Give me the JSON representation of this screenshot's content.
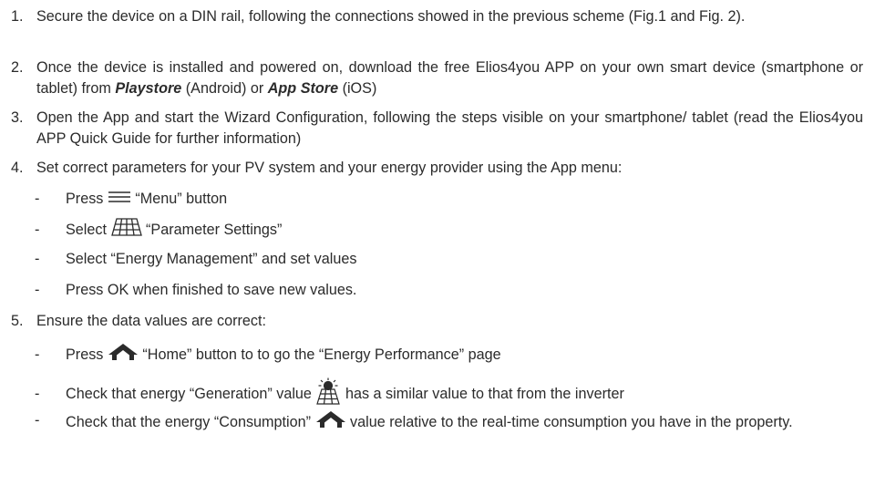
{
  "steps": [
    {
      "num": "1.",
      "text": "Secure the device on a DIN rail, following the connections showed in the previous scheme (Fig.1 and Fig. 2)."
    },
    {
      "num": "2.",
      "text_a": "Once the device is installed and powered on, download the free Elios4you APP on your own smart device (smartphone or tablet) from ",
      "link_playstore": "Playstore",
      "text_b": " (Android) or ",
      "link_appstore": "App Store",
      "text_c": " (iOS)"
    },
    {
      "num": "3.",
      "text": "Open the App and start the Wizard Configuration, following the steps visible on your smartphone/ tablet (read the Elios4you APP Quick Guide for further information)"
    },
    {
      "num": "4.",
      "text": "Set correct parameters for your PV system and your energy provider using the App menu:",
      "subs": [
        {
          "dash": "-",
          "pre": "Press",
          "post": "“Menu” button"
        },
        {
          "dash": "-",
          "pre": "Select",
          "post": "“Parameter Settings”"
        },
        {
          "dash": "-",
          "text": "Select “Energy Management” and set values"
        },
        {
          "dash": "-",
          "text": "Press OK when finished to save new values."
        }
      ]
    },
    {
      "num": "5.",
      "text": "Ensure the data values are correct:",
      "subs": [
        {
          "dash": "-",
          "pre": "Press",
          "post": "“Home” button to to go the “Energy Performance” page"
        },
        {
          "dash": "-",
          "pre": "Check that energy “Generation” value",
          "post": "has a similar value to that from the inverter"
        },
        {
          "dash": "-",
          "pre": "Check that the energy “Consumption”",
          "post": "value relative to the real-time consumption you have in the property."
        }
      ]
    }
  ],
  "icons": {
    "menu": "menu-lines-icon",
    "parameters": "grid-panel-icon",
    "home": "home-icon",
    "generation": "sun-panel-icon",
    "consumption": "roof-icon"
  },
  "colors": {
    "text": "#2b2b2b",
    "icon": "#2b2b2b"
  }
}
